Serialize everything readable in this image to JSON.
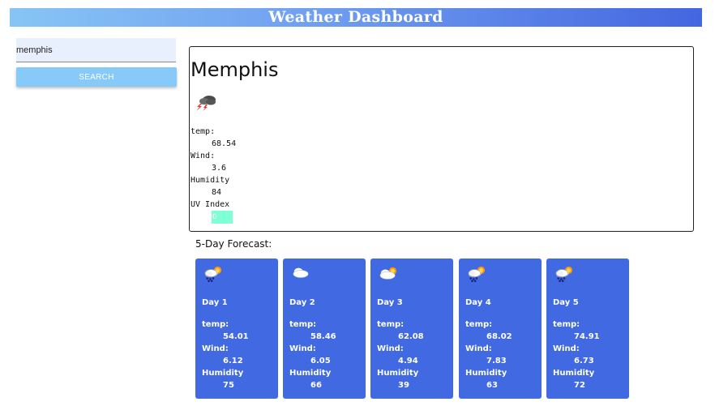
{
  "app": {
    "title": "Weather Dashboard"
  },
  "search": {
    "value": "memphis",
    "button_label": "SEARCH"
  },
  "current": {
    "city": "Memphis",
    "icon": "thunderstorm-rain-icon",
    "temp_label": "temp:",
    "temp": "68.54",
    "wind_label": "Wind:",
    "wind": "3.6",
    "humidity_label": "Humidity",
    "humidity": "84",
    "uv_label": "UV Index",
    "uv": "0",
    "uv_color": "#7fffd4"
  },
  "forecast": {
    "title": "5-Day Forecast:",
    "card_color": "#4169e1",
    "days": [
      {
        "day": "Day 1",
        "icon": "rain-sun-cloud-icon",
        "temp_label": "temp:",
        "temp": "54.01",
        "wind_label": "Wind:",
        "wind": "6.12",
        "humidity_label": "Humidity",
        "humidity": "75"
      },
      {
        "day": "Day 2",
        "icon": "cloud-icon",
        "temp_label": "temp:",
        "temp": "58.46",
        "wind_label": "Wind:",
        "wind": "6.05",
        "humidity_label": "Humidity",
        "humidity": "66"
      },
      {
        "day": "Day 3",
        "icon": "partly-cloudy-icon",
        "temp_label": "temp:",
        "temp": "62.08",
        "wind_label": "Wind:",
        "wind": "4.94",
        "humidity_label": "Humidity",
        "humidity": "39"
      },
      {
        "day": "Day 4",
        "icon": "rain-sun-cloud-icon",
        "temp_label": "temp:",
        "temp": "68.02",
        "wind_label": "Wind:",
        "wind": "7.83",
        "humidity_label": "Humidity",
        "humidity": "63"
      },
      {
        "day": "Day 5",
        "icon": "rain-sun-cloud-icon",
        "temp_label": "temp:",
        "temp": "74.91",
        "wind_label": "Wind:",
        "wind": "6.73",
        "humidity_label": "Humidity",
        "humidity": "72"
      }
    ]
  }
}
